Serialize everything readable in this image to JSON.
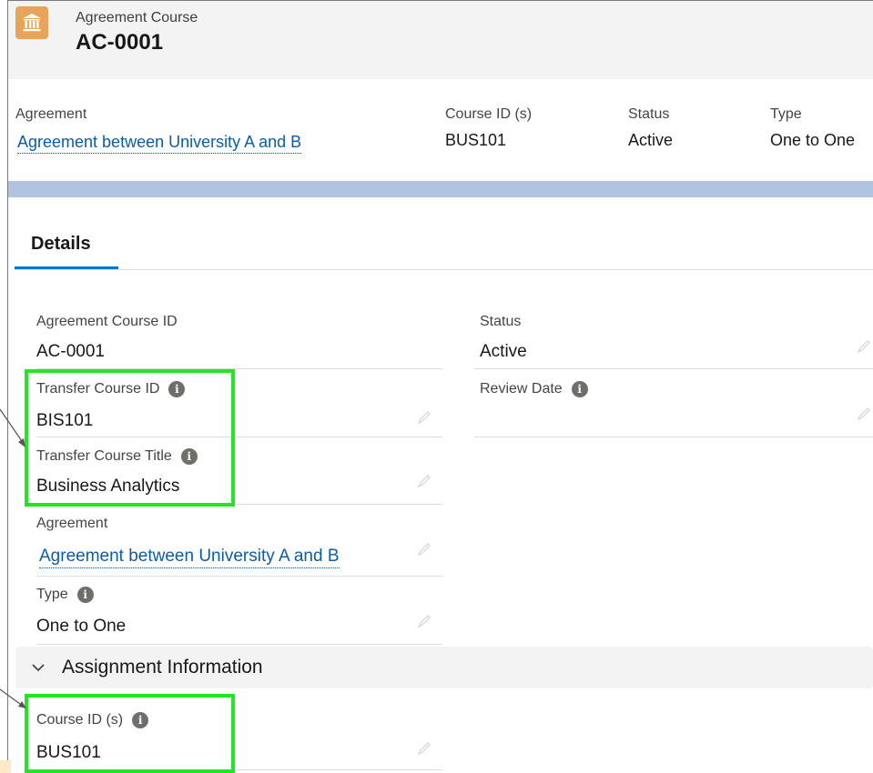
{
  "header": {
    "object_label": "Agreement Course",
    "record_title": "AC-0001",
    "icon": "institution-icon",
    "icon_color": "#e6a55a"
  },
  "highlights": {
    "agreement_label": "Agreement",
    "agreement_value": "Agreement between University A and B",
    "course_ids_label": "Course ID (s)",
    "course_ids_value": "BUS101",
    "status_label": "Status",
    "status_value": "Active",
    "type_label": "Type",
    "type_value": "One to One"
  },
  "tabs": {
    "details": "Details"
  },
  "details": {
    "agreement_course_id_label": "Agreement Course ID",
    "agreement_course_id_value": "AC-0001",
    "status_label": "Status",
    "status_value": "Active",
    "transfer_course_id_label": "Transfer Course ID",
    "transfer_course_id_value": "BIS101",
    "review_date_label": "Review Date",
    "review_date_value": "",
    "transfer_course_title_label": "Transfer Course Title",
    "transfer_course_title_value": "Business Analytics",
    "agreement_label": "Agreement",
    "agreement_value": "Agreement between University A and B",
    "type_label": "Type",
    "type_value": "One to One"
  },
  "assignment_section": {
    "title": "Assignment Information",
    "course_ids_label": "Course ID (s)",
    "course_ids_value": "BUS101"
  },
  "colors": {
    "link": "#0b5cab",
    "active_tab": "#0176d3",
    "highlight_box": "#22e622",
    "band": "#b0c4df"
  }
}
